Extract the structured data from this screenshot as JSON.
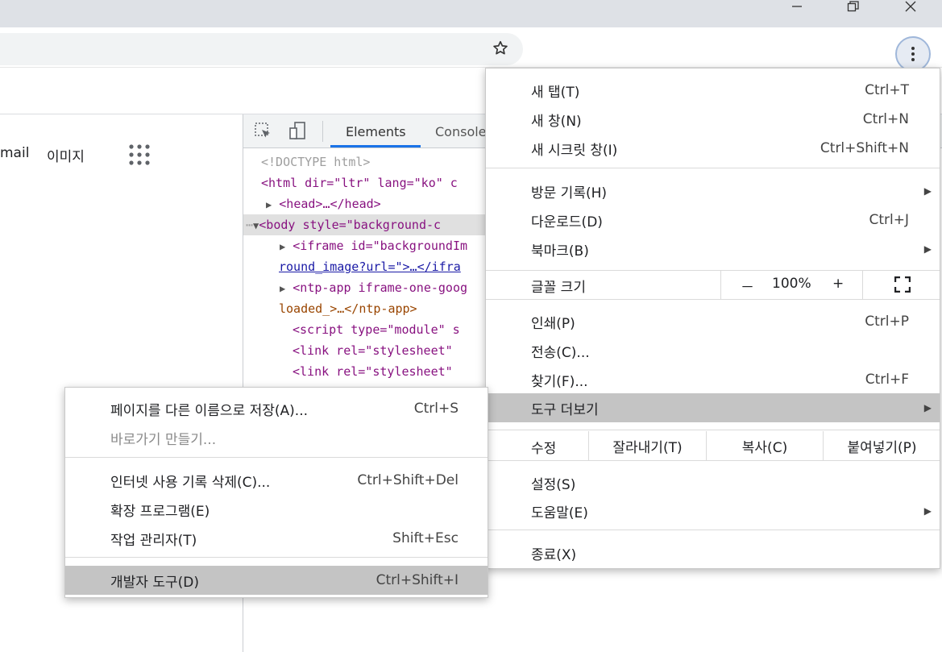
{
  "window": {
    "minimize_icon": "minimize-icon",
    "maximize_icon": "restore-icon",
    "close_icon": "close-icon"
  },
  "page": {
    "gmail": "mail",
    "images": "이미지"
  },
  "devtools": {
    "tabs": [
      "Elements",
      "Console"
    ],
    "lines": [
      "<!DOCTYPE html>",
      "<html dir=\"ltr\" lang=\"ko\" c",
      "<head>…</head>",
      "<body style=\"background-c",
      "<iframe id=\"backgroundIm",
      "round_image?url=\">…</ifra",
      "<ntp-app iframe-one-goog",
      "loaded_>…</ntp-app>",
      "<script type=\"module\" s",
      "<link rel=\"stylesheet\" ",
      "<link rel=\"stylesheet\" "
    ]
  },
  "main_menu": {
    "new_tab": {
      "label": "새 탭(T)",
      "shortcut": "Ctrl+T"
    },
    "new_window": {
      "label": "새 창(N)",
      "shortcut": "Ctrl+N"
    },
    "incognito": {
      "label": "새 시크릿 창(I)",
      "shortcut": "Ctrl+Shift+N"
    },
    "history": {
      "label": "방문 기록(H)"
    },
    "downloads": {
      "label": "다운로드(D)",
      "shortcut": "Ctrl+J"
    },
    "bookmarks": {
      "label": "북마크(B)"
    },
    "zoom": {
      "label": "글꼴 크기",
      "minus": "－",
      "value": "100%",
      "plus": "+"
    },
    "print": {
      "label": "인쇄(P)",
      "shortcut": "Ctrl+P"
    },
    "cast": {
      "label": "전송(C)..."
    },
    "find": {
      "label": "찾기(F)...",
      "shortcut": "Ctrl+F"
    },
    "more_tools": {
      "label": "도구 더보기"
    },
    "edit": {
      "label": "수정",
      "cut": "잘라내기(T)",
      "copy": "복사(C)",
      "paste": "붙여넣기(P)"
    },
    "settings": {
      "label": "설정(S)"
    },
    "help": {
      "label": "도움말(E)"
    },
    "exit": {
      "label": "종료(X)"
    }
  },
  "sub_menu": {
    "save_as": {
      "label": "페이지를 다른 이름으로 저장(A)...",
      "shortcut": "Ctrl+S"
    },
    "shortcut": {
      "label": "바로가기 만들기..."
    },
    "clear_data": {
      "label": "인터넷 사용 기록 삭제(C)...",
      "shortcut": "Ctrl+Shift+Del"
    },
    "extensions": {
      "label": "확장 프로그램(E)"
    },
    "task_manager": {
      "label": "작업 관리자(T)",
      "shortcut": "Shift+Esc"
    },
    "dev_tools": {
      "label": "개발자 도구(D)",
      "shortcut": "Ctrl+Shift+I"
    }
  }
}
